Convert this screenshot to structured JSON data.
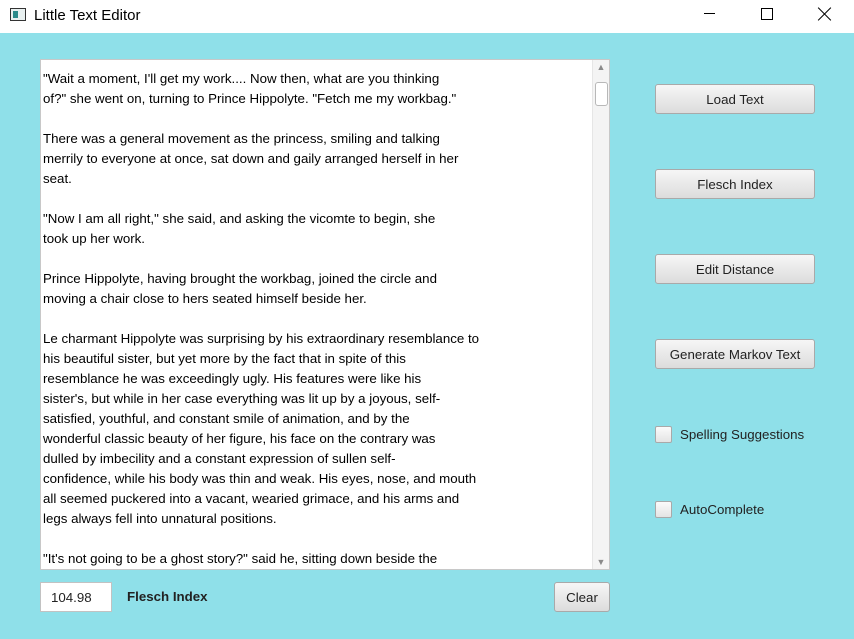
{
  "window": {
    "title": "Little Text Editor"
  },
  "editor": {
    "text": "\"Wait a moment, I'll get my work.... Now then, what are you thinking\nof?\" she went on, turning to Prince Hippolyte. \"Fetch me my workbag.\"\n\nThere was a general movement as the princess, smiling and talking\nmerrily to everyone at once, sat down and gaily arranged herself in her\nseat.\n\n\"Now I am all right,\" she said, and asking the vicomte to begin, she\ntook up her work.\n\nPrince Hippolyte, having brought the workbag, joined the circle and\nmoving a chair close to hers seated himself beside her.\n\nLe charmant Hippolyte was surprising by his extraordinary resemblance to\nhis beautiful sister, but yet more by the fact that in spite of this\nresemblance he was exceedingly ugly. His features were like his\nsister's, but while in her case everything was lit up by a joyous, self-\nsatisfied, youthful, and constant smile of animation, and by the\nwonderful classic beauty of her figure, his face on the contrary was\ndulled by imbecility and a constant expression of sullen self-\nconfidence, while his body was thin and weak. His eyes, nose, and mouth\nall seemed puckered into a vacant, wearied grimace, and his arms and\nlegs always fell into unnatural positions.\n\n\"It's not going to be a ghost story?\" said he, sitting down beside the"
  },
  "sidebar": {
    "load_label": "Load Text",
    "flesch_label": "Flesch Index",
    "edit_distance_label": "Edit Distance",
    "markov_label": "Generate Markov Text",
    "spelling_label": "Spelling Suggestions",
    "spelling_checked": false,
    "autocomplete_label": "AutoComplete",
    "autocomplete_checked": false
  },
  "footer": {
    "index_value": "104.98",
    "index_label": "Flesch Index",
    "clear_label": "Clear"
  },
  "colors": {
    "background": "#8fe0e9",
    "button_face": "#e8e8e8"
  }
}
